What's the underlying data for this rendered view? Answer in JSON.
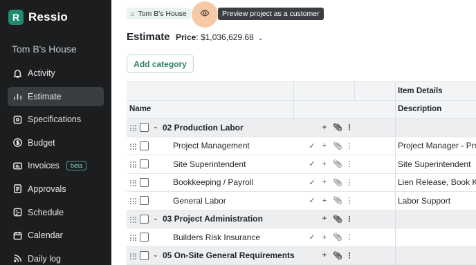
{
  "brand": {
    "mark": "R",
    "name": "Ressio"
  },
  "sidebar": {
    "project": "Tom B's House",
    "items": [
      {
        "label": "Activity",
        "icon": "bell-icon",
        "active": false
      },
      {
        "label": "Estimate",
        "icon": "chart-icon",
        "active": true
      },
      {
        "label": "Specifications",
        "icon": "target-icon",
        "active": false
      },
      {
        "label": "Budget",
        "icon": "dollar-icon",
        "active": false
      },
      {
        "label": "Invoices",
        "icon": "invoice-icon",
        "active": false,
        "badge": "beta"
      },
      {
        "label": "Approvals",
        "icon": "approval-icon",
        "active": false
      },
      {
        "label": "Schedule",
        "icon": "schedule-icon",
        "active": false
      },
      {
        "label": "Calendar",
        "icon": "calendar-icon",
        "active": false
      },
      {
        "label": "Daily log",
        "icon": "rss-icon",
        "active": false
      }
    ]
  },
  "breadcrumb": {
    "home_icon": "⌂",
    "label": "Tom B's House"
  },
  "tooltip": "Preview project as a customer",
  "header": {
    "title": "Estimate",
    "price_label": "Price",
    "price_value": ": $1,036,629.68",
    "chevron": "⌄"
  },
  "add_category": "Add category",
  "table": {
    "group_header": "Item Details",
    "col_name": "Name",
    "col_desc": "Description",
    "rows": [
      {
        "type": "category",
        "name": "02 Production Labor",
        "desc": ""
      },
      {
        "type": "item",
        "name": "Project Management",
        "desc": "Project Manager - Pro"
      },
      {
        "type": "item",
        "name": "Site Superintendent",
        "desc": "Site Superintendent"
      },
      {
        "type": "item",
        "name": "Bookkeeping / Payroll",
        "desc": "Lien Release, Book Ke"
      },
      {
        "type": "item",
        "name": "General Labor",
        "desc": "Labor Support"
      },
      {
        "type": "category",
        "name": "03 Project Administration",
        "desc": ""
      },
      {
        "type": "item",
        "name": "Builders Risk Insurance",
        "desc": ""
      },
      {
        "type": "category",
        "name": "05 On-Site General Requirements",
        "desc": ""
      }
    ]
  },
  "icons": {
    "caret": "⌄",
    "plus": "+",
    "clip": "⊘",
    "kebab": "⋮",
    "check": "✓"
  },
  "colors": {
    "sidebar_bg": "#1b1d1f",
    "accent": "#1e8a6f",
    "highlight": "#f6c9a7"
  }
}
